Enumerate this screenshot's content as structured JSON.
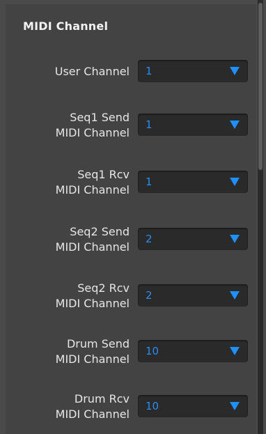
{
  "section": {
    "title": "MIDI Channel"
  },
  "rows": [
    {
      "label": "User Channel",
      "value": "1"
    },
    {
      "label": "Seq1 Send\nMIDI Channel",
      "value": "1"
    },
    {
      "label": "Seq1 Rcv\nMIDI Channel",
      "value": "1"
    },
    {
      "label": "Seq2 Send\nMIDI Channel",
      "value": "2"
    },
    {
      "label": "Seq2 Rcv\nMIDI Channel",
      "value": "2"
    },
    {
      "label": "Drum Send\nMIDI Channel",
      "value": "10"
    },
    {
      "label": "Drum Rcv\nMIDI Channel",
      "value": "10"
    }
  ],
  "colors": {
    "background": "#4a4a4a",
    "select_bg": "#2a2a2a",
    "value_text": "#2d8cf0",
    "label_text": "#e6e6e6"
  },
  "icons": {
    "dropdown": "triangle-down-icon"
  }
}
